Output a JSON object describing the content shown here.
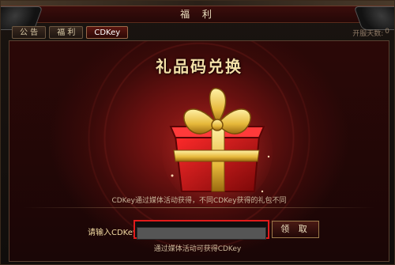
{
  "window": {
    "title": "福 利"
  },
  "tabs": [
    {
      "label": "公 告",
      "active": false
    },
    {
      "label": "福 利",
      "active": false
    },
    {
      "label": "CDKey",
      "active": true
    }
  ],
  "server_days": {
    "label": "开服天数:",
    "value": "0"
  },
  "redeem": {
    "heading": "礼品码兑换",
    "description": "CDKey通过媒体活动获得，不同CDKey获得的礼包不同",
    "input_label": "请输入CDKey:",
    "input_value": "",
    "input_placeholder": "",
    "claim_button": "领 取",
    "tip": "通过媒体活动可获得CDKey"
  },
  "colors": {
    "title_bar": "#3b0d0b",
    "panel_bg": "#5c1411",
    "gold": "#f3e0a8",
    "input_border": "#e01b1b"
  },
  "icons": [
    "gift-box-icon",
    "ornate-corner-left",
    "ornate-corner-right"
  ]
}
